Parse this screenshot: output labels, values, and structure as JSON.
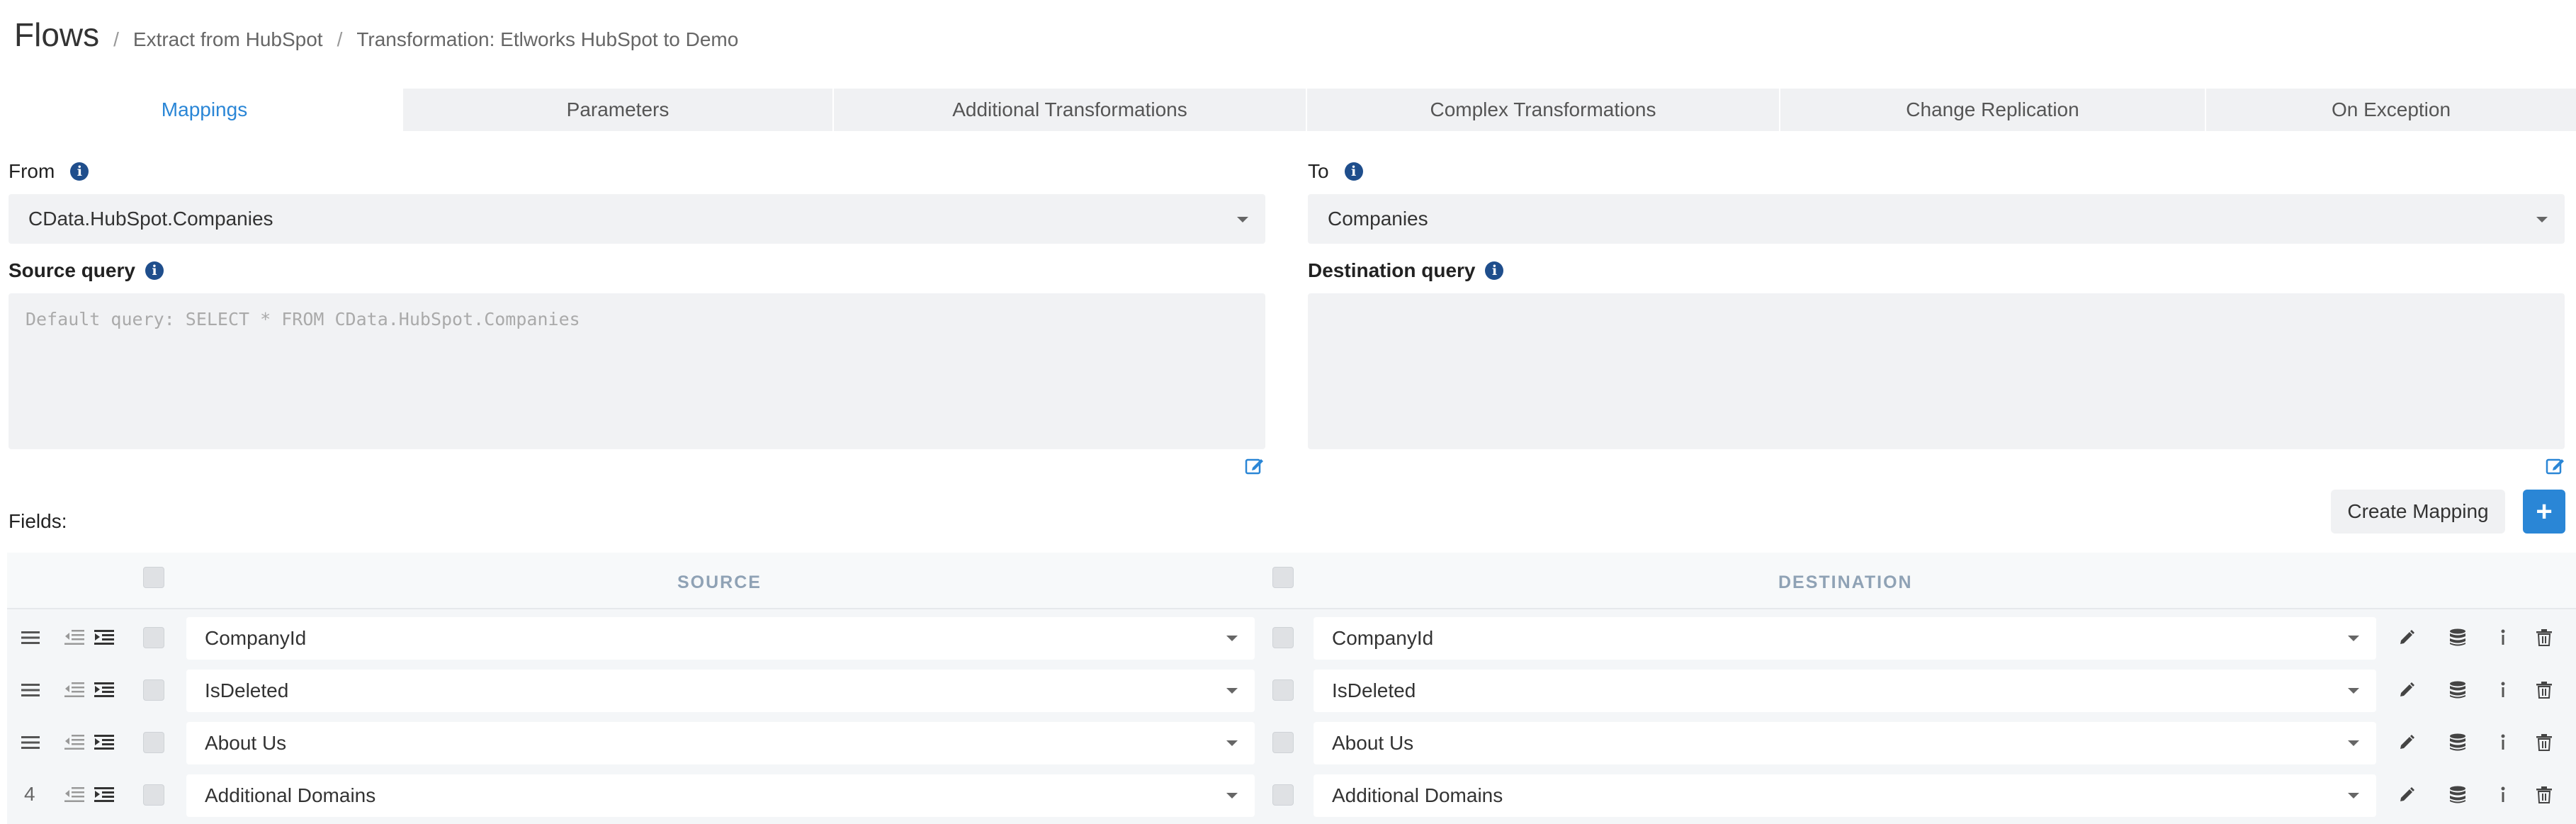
{
  "header": {
    "title": "Flows",
    "breadcrumb": [
      "Extract from HubSpot",
      "Transformation: Etlworks HubSpot to Demo"
    ]
  },
  "tabs": [
    {
      "label": "Mappings",
      "active": true
    },
    {
      "label": "Parameters"
    },
    {
      "label": "Additional Transformations"
    },
    {
      "label": "Complex Transformations"
    },
    {
      "label": "Change Replication"
    },
    {
      "label": "On Exception"
    }
  ],
  "from": {
    "label": "From",
    "value": "CData.HubSpot.Companies"
  },
  "to": {
    "label": "To",
    "value": "Companies"
  },
  "source_query": {
    "label": "Source query",
    "placeholder": "Default query: SELECT * FROM CData.HubSpot.Companies"
  },
  "destination_query": {
    "label": "Destination query",
    "placeholder": ""
  },
  "fields_label": "Fields:",
  "buttons": {
    "create_mapping": "Create Mapping",
    "add": "+"
  },
  "grid": {
    "source_header": "SOURCE",
    "destination_header": "DESTINATION",
    "rows": [
      {
        "num": "",
        "source": "CompanyId",
        "destination": "CompanyId"
      },
      {
        "num": "",
        "source": "IsDeleted",
        "destination": "IsDeleted"
      },
      {
        "num": "",
        "source": "About Us",
        "destination": "About Us"
      },
      {
        "num": "4",
        "source": "Additional Domains",
        "destination": "Additional Domains"
      }
    ]
  },
  "colors": {
    "accent": "#2a86d6",
    "info": "#1f4e8c"
  }
}
